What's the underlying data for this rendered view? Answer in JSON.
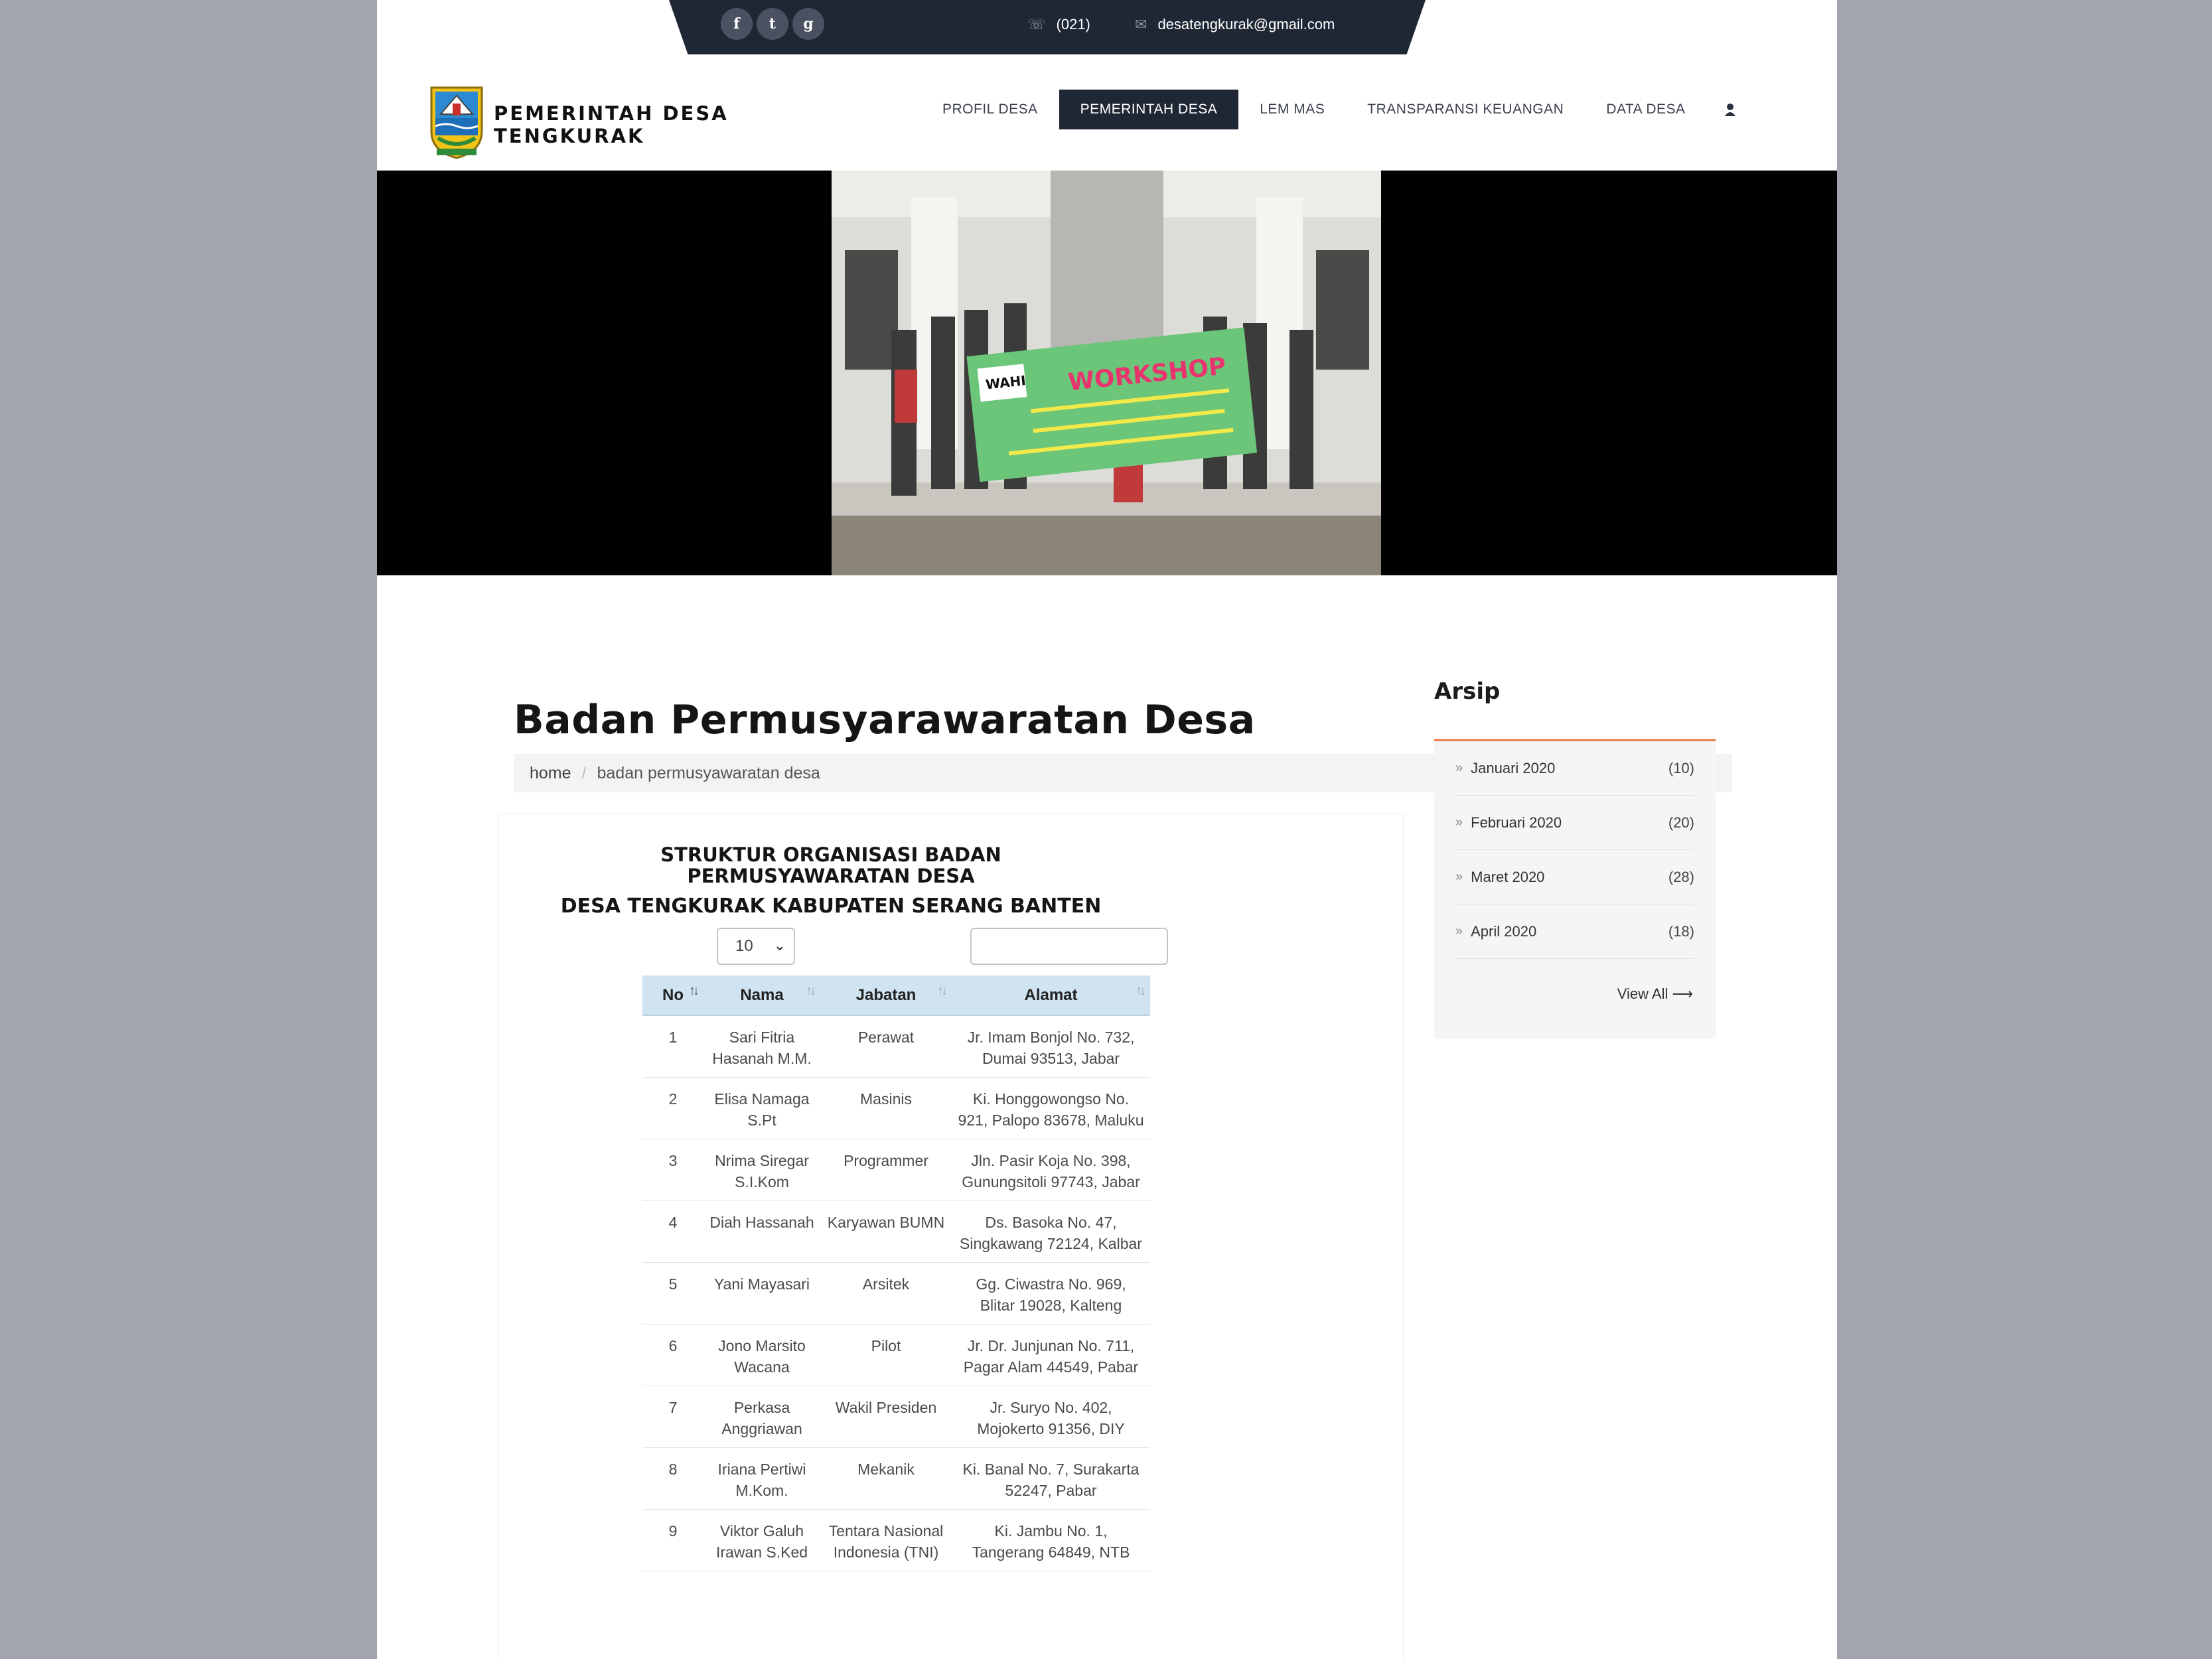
{
  "topbar": {
    "social": [
      {
        "name": "facebook-icon",
        "glyph": "f"
      },
      {
        "name": "twitter-icon",
        "glyph": "t"
      },
      {
        "name": "google-plus-icon",
        "glyph": "g"
      }
    ],
    "phone": "(021)",
    "email": "desatengkurak@gmail.com"
  },
  "brand": {
    "line1": "PEMERINTAH DESA",
    "line2": "TENGKURAK"
  },
  "nav": {
    "items": [
      "PROFIL DESA",
      "PEMERINTAH DESA",
      "LEM MAS",
      "TRANSPARANSI KEUANGAN",
      "DATA DESA"
    ],
    "active_index": 1,
    "user_icon": "user-icon"
  },
  "hero": {
    "banner_text": "WORKSHOP",
    "banner_sub": "WAHI"
  },
  "page": {
    "title": "Badan Permusyarawaratan Desa",
    "breadcrumb": {
      "home": "home",
      "current": "badan permusyawaratan desa"
    }
  },
  "struct": {
    "title_line1": "STRUKTUR ORGANISASI BADAN",
    "title_line2": "PERMUSYAWARATAN DESA",
    "subtitle": "DESA TENGKURAK KABUPATEN SERANG BANTEN",
    "length_value": "10",
    "search_value": ""
  },
  "table": {
    "headers": [
      "No",
      "Nama",
      "Jabatan",
      "Alamat"
    ],
    "rows": [
      {
        "no": "1",
        "nama": "Sari Fitria Hasanah M.M.",
        "jabatan": "Perawat",
        "alamat": "Jr. Imam Bonjol No. 732, Dumai 93513, Jabar"
      },
      {
        "no": "2",
        "nama": "Elisa Namaga S.Pt",
        "jabatan": "Masinis",
        "alamat": "Ki. Honggowongso No. 921, Palopo 83678, Maluku"
      },
      {
        "no": "3",
        "nama": "Nrima Siregar S.I.Kom",
        "jabatan": "Programmer",
        "alamat": "Jln. Pasir Koja No. 398, Gunungsitoli 97743, Jabar"
      },
      {
        "no": "4",
        "nama": "Diah Hassanah",
        "jabatan": "Karyawan BUMN",
        "alamat": "Ds. Basoka No. 47, Singkawang 72124, Kalbar"
      },
      {
        "no": "5",
        "nama": "Yani Mayasari",
        "jabatan": "Arsitek",
        "alamat": "Gg. Ciwastra No. 969, Blitar 19028, Kalteng"
      },
      {
        "no": "6",
        "nama": "Jono Marsito Wacana",
        "jabatan": "Pilot",
        "alamat": "Jr. Dr. Junjunan No. 711, Pagar Alam 44549, Pabar"
      },
      {
        "no": "7",
        "nama": "Perkasa Anggriawan",
        "jabatan": "Wakil Presiden",
        "alamat": "Jr. Suryo No. 402, Mojokerto 91356, DIY"
      },
      {
        "no": "8",
        "nama": "Iriana Pertiwi M.Kom.",
        "jabatan": "Mekanik",
        "alamat": "Ki. Banal No. 7, Surakarta 52247, Pabar"
      },
      {
        "no": "9",
        "nama": "Viktor Galuh Irawan S.Ked",
        "jabatan": "Tentara Nasional Indonesia (TNI)",
        "alamat": "Ki. Jambu No. 1, Tangerang 64849, NTB"
      }
    ]
  },
  "sidebar": {
    "title": "Arsip",
    "items": [
      {
        "label": "Januari 2020",
        "count": "(10)"
      },
      {
        "label": "Februari 2020",
        "count": "(20)"
      },
      {
        "label": "Maret 2020",
        "count": "(28)"
      },
      {
        "label": "April 2020",
        "count": "(18)"
      }
    ],
    "view_all": "View All ⟶"
  },
  "colors": {
    "dark": "#1f2735",
    "accent": "#f07a4a",
    "table_header": "#cfe3f1"
  }
}
